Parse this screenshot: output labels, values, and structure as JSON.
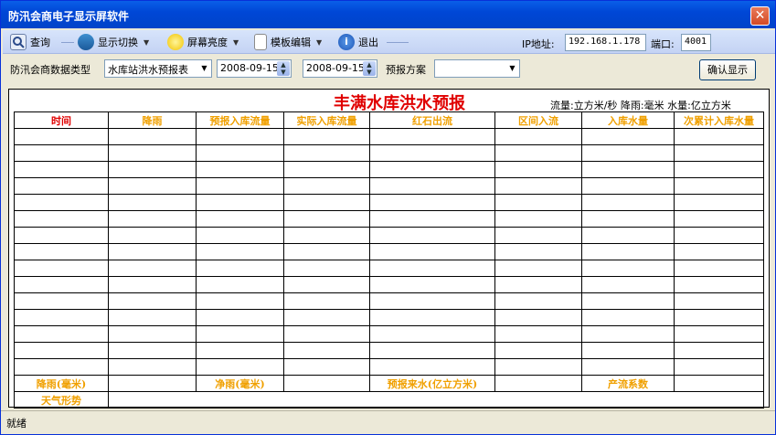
{
  "window": {
    "title": "防汛会商电子显示屏软件",
    "close_glyph": "✕"
  },
  "toolbar": {
    "query": "查询",
    "display_switch": "显示切换",
    "brightness": "屏幕亮度",
    "template_edit": "模板编辑",
    "exit": "退出",
    "ip_label": "IP地址:",
    "ip_value": "192.168.1.178",
    "port_label": "端口:",
    "port_value": "4001"
  },
  "filters": {
    "type_label": "防汛会商数据类型",
    "type_value": "水库站洪水预报表",
    "date_from": "2008-09-15",
    "date_to": "2008-09-15",
    "scheme_label": "预报方案",
    "scheme_value": "",
    "confirm_button": "确认显示"
  },
  "report": {
    "title": "丰满水库洪水预报",
    "units": "流量:立方米/秒 降雨:毫米 水量:亿立方米",
    "headers": [
      "时间",
      "降雨",
      "预报入库流量",
      "实际入库流量",
      "红石出流",
      "区间入流",
      "入库水量",
      "次累计入库水量"
    ],
    "empty_rows": 15,
    "footer1": [
      "降雨(毫米)",
      "",
      "净雨(毫米)",
      "",
      "预报来水(亿立方米)",
      "",
      "产流系数",
      ""
    ],
    "footer2_label": "天气形势"
  },
  "status": {
    "text": "就绪"
  },
  "colors": {
    "title_red": "#e00000",
    "header_orange": "#f0a000",
    "toolbar_blue": "#c4d3f4"
  }
}
